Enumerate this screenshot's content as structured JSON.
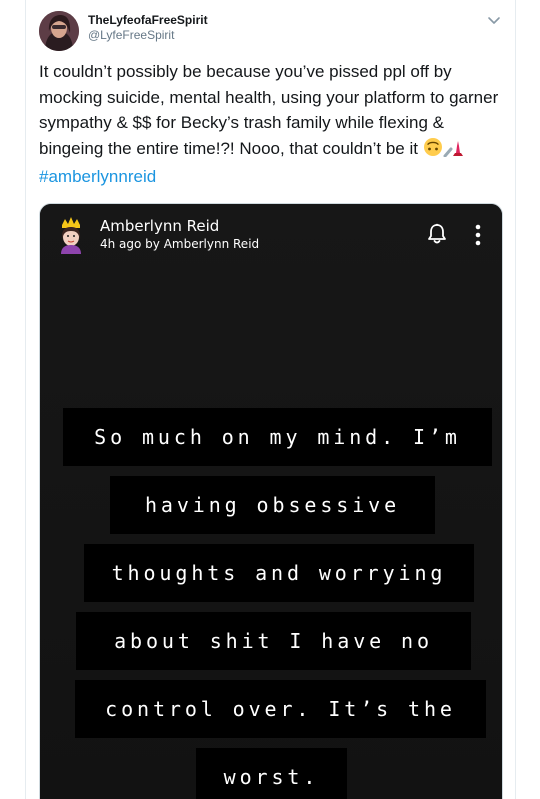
{
  "tweet": {
    "display_name": "TheLyfeofaFreeSpirit",
    "handle": "@LyfeFreeSpirit",
    "text_before_hashtag": "It couldn’t possibly be because you’ve pissed ppl off by mocking suicide, mental health, using your platform to garner sympathy & $$ for Becky’s trash family while flexing & bingeing the entire time!?! Nooo, that couldn’t be it",
    "emojis": [
      "upside-down-face-icon",
      "nail-polish-icon"
    ],
    "hashtag": "#amberlynnreid"
  },
  "media": {
    "story_name": "Amberlynn Reid",
    "story_time": "4h ago by Amberlynn Reid",
    "caption_lines": [
      "So much on my mind. I’m",
      "having obsessive",
      "thoughts and worrying",
      "about shit I have no",
      "control over. It’s the",
      "worst."
    ]
  },
  "colors": {
    "name_text": "#14171a",
    "handle_text": "#657786",
    "hashtag": "#1b95e0",
    "card_border": "#e6ecf0",
    "media_bg": "#161616",
    "caption_bg": "#000000",
    "caption_text": "#ffffff"
  }
}
